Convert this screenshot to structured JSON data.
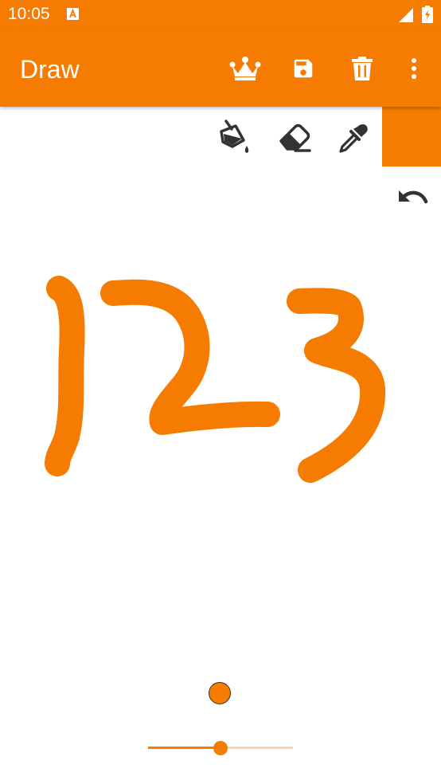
{
  "status_bar": {
    "time": "10:05",
    "notification_icon": "app-notification-icon",
    "signal_icon": "signal-icon",
    "battery_icon": "battery-charging-icon"
  },
  "app_bar": {
    "title": "Draw",
    "actions": [
      {
        "name": "premium",
        "icon": "crown-icon"
      },
      {
        "name": "save",
        "icon": "save-icon"
      },
      {
        "name": "delete",
        "icon": "trash-icon"
      },
      {
        "name": "more",
        "icon": "more-vert-icon"
      }
    ]
  },
  "tools": [
    {
      "name": "fill",
      "icon": "paint-bucket-icon"
    },
    {
      "name": "eraser",
      "icon": "eraser-icon"
    },
    {
      "name": "color-picker",
      "icon": "eyedropper-icon"
    }
  ],
  "undo_icon": "undo-icon",
  "drawing": {
    "content": "123",
    "stroke_color": "#f57c00"
  },
  "brush": {
    "color": "#f57c00",
    "size_fraction": 0.5
  },
  "colors": {
    "accent": "#f57c00",
    "icon_dark": "#333333",
    "background": "#ffffff",
    "slider_track": "#fcd3ad"
  }
}
